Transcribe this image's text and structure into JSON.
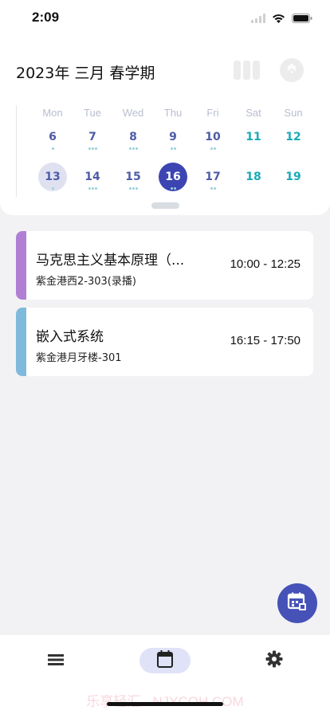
{
  "status": {
    "time": "2:09"
  },
  "header": {
    "term_title": "2023年 三月 春学期"
  },
  "calendar": {
    "weekdays": [
      "Mon",
      "Tue",
      "Wed",
      "Thu",
      "Fri",
      "Sat",
      "Sun"
    ],
    "weeks": [
      [
        "6",
        "7",
        "8",
        "9",
        "10",
        "11",
        "12"
      ],
      [
        "13",
        "14",
        "15",
        "16",
        "17",
        "18",
        "19"
      ]
    ],
    "today": "13",
    "selected": "16",
    "weekday_color": "#4e5ba6",
    "weekend_color": "#18aab8",
    "selected_color": "#3c45b2"
  },
  "courses": [
    {
      "name": "马克思主义基本原理（...",
      "room": "紫金港西2-303(录播)",
      "time": "10:00 - 12:25",
      "color": "#b07fd4"
    },
    {
      "name": "嵌入式系统",
      "room": "紫金港月牙楼-301",
      "time": "16:15 - 17:50",
      "color": "#7fbadd"
    }
  ],
  "fab": {
    "icon": "calendar-edit-icon",
    "color": "#4652b7"
  },
  "nav": {
    "items": [
      "list-icon",
      "calendar-icon",
      "gear-icon"
    ],
    "active": "calendar-icon"
  },
  "watermark": "乐享轻汇 · NJYCOH.COM"
}
